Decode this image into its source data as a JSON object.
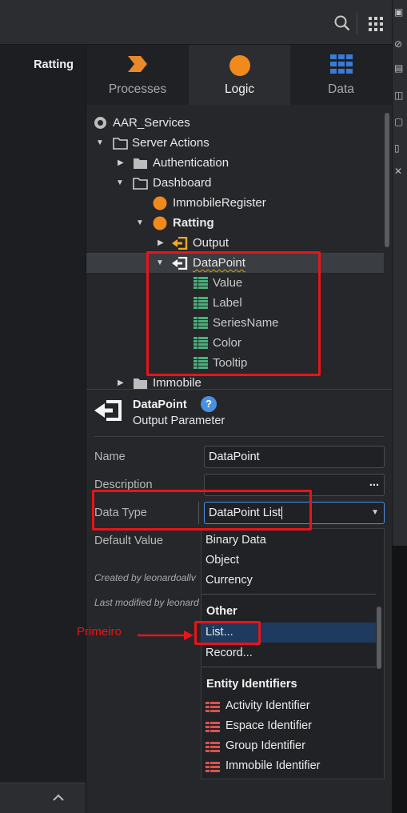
{
  "topbar": {
    "search_icon": "search-icon",
    "grid_icon": "grid-icon"
  },
  "left_panel": {
    "title": "Ratting"
  },
  "tabs": [
    {
      "label": "Processes",
      "icon": "processes-icon",
      "color": "#e8892b"
    },
    {
      "label": "Logic",
      "icon": "logic-icon",
      "color": "#f08a1c"
    },
    {
      "label": "Data",
      "icon": "data-icon",
      "color": "#3a7bd5"
    }
  ],
  "tree": {
    "items": [
      {
        "label": "AAR_Services"
      },
      {
        "label": "Server Actions"
      },
      {
        "label": "Authentication"
      },
      {
        "label": "Dashboard"
      },
      {
        "label": "ImmobileRegister"
      },
      {
        "label": "Ratting"
      },
      {
        "label": "Output"
      },
      {
        "label": "DataPoint"
      },
      {
        "label": "Value"
      },
      {
        "label": "Label"
      },
      {
        "label": "SeriesName"
      },
      {
        "label": "Color"
      },
      {
        "label": "Tooltip"
      },
      {
        "label": "Immobile"
      }
    ]
  },
  "properties": {
    "title": "DataPoint",
    "help": "?",
    "subtitle": "Output Parameter",
    "name_label": "Name",
    "name_value": "DataPoint",
    "description_label": "Description",
    "description_button": "...",
    "datatype_label": "Data Type",
    "datatype_value": "DataPoint List",
    "default_label": "Default Value",
    "created_by": "Created by leonardoallv",
    "modified_by": "Last modified by leonard"
  },
  "dropdown": {
    "top_items": [
      "Binary Data",
      "Object",
      "Currency"
    ],
    "other_header": "Other",
    "other_items": [
      "List...",
      "Record..."
    ],
    "entity_header": "Entity Identifiers",
    "entity_items": [
      "Activity Identifier",
      "Espace Identifier",
      "Group Identifier",
      "Immobile Identifier"
    ]
  },
  "annotation": {
    "text": "Primeiro"
  },
  "colors": {
    "accent": "#4a90e2",
    "highlight": "#e8141b",
    "orange": "#f08a1c"
  }
}
